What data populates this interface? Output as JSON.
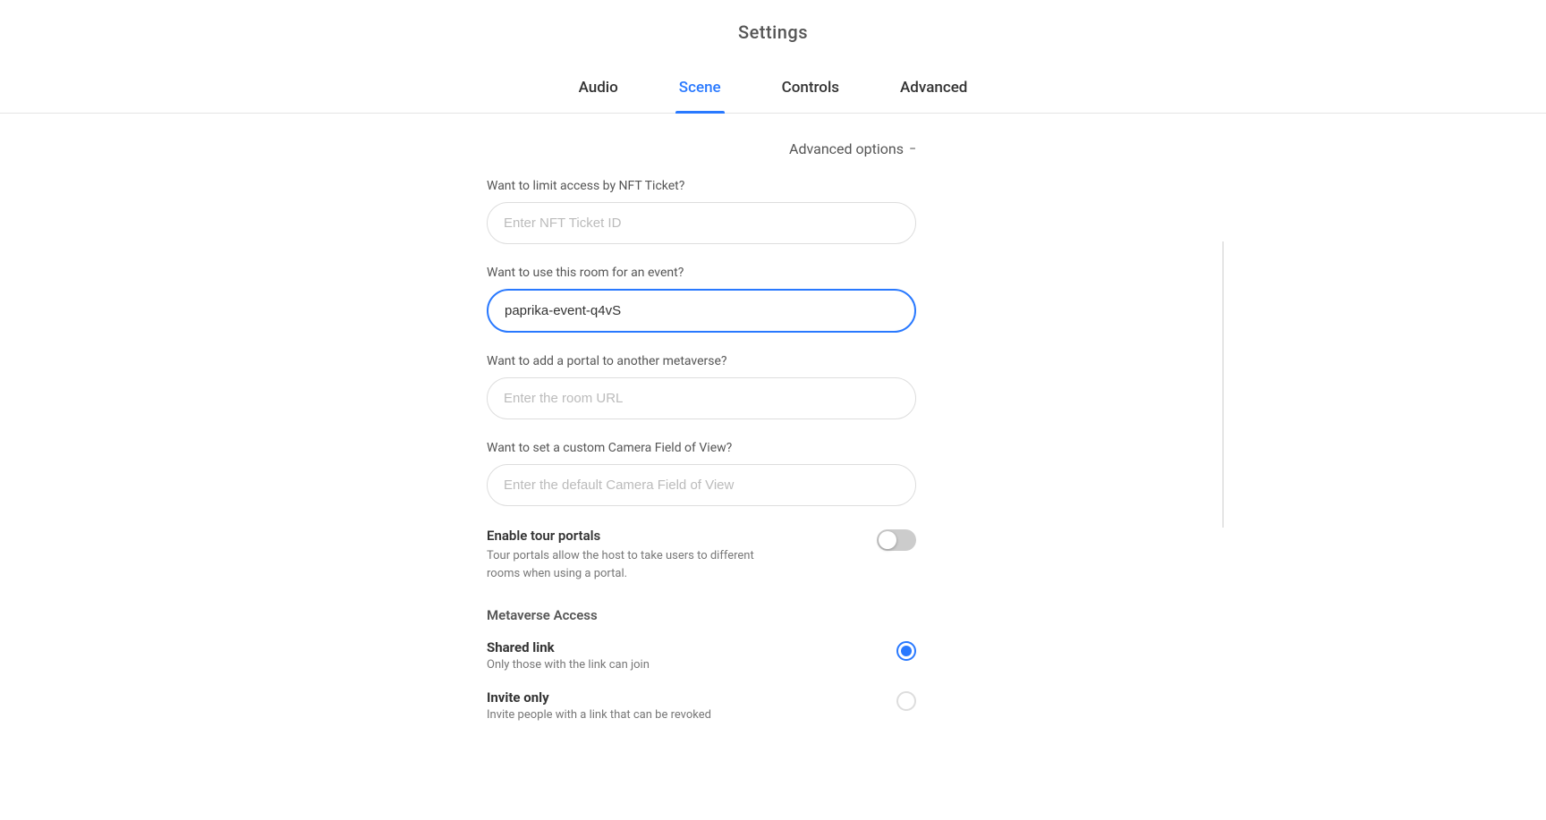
{
  "page": {
    "title": "Settings"
  },
  "tabs": [
    {
      "id": "audio",
      "label": "Audio",
      "active": false
    },
    {
      "id": "scene",
      "label": "Scene",
      "active": true
    },
    {
      "id": "controls",
      "label": "Controls",
      "active": false
    },
    {
      "id": "advanced",
      "label": "Advanced",
      "active": false
    }
  ],
  "advanced_options": {
    "header_label": "Advanced options",
    "chevron": "−"
  },
  "form": {
    "nft_ticket": {
      "label": "Want to limit access by NFT Ticket?",
      "placeholder": "Enter NFT Ticket ID",
      "value": ""
    },
    "event_room": {
      "label": "Want to use this room for an event?",
      "placeholder": "",
      "value": "paprika-event-q4vS"
    },
    "portal_url": {
      "label": "Want to add a portal to another metaverse?",
      "placeholder": "Enter the room URL",
      "value": ""
    },
    "camera_fov": {
      "label": "Want to set a custom Camera Field of View?",
      "placeholder": "Enter the default Camera Field of View",
      "value": ""
    }
  },
  "toggle": {
    "label": "Enable tour portals",
    "description": "Tour portals allow the host to take users to different rooms when using a portal.",
    "enabled": false
  },
  "metaverse_access": {
    "section_label": "Metaverse Access",
    "options": [
      {
        "id": "shared_link",
        "label": "Shared link",
        "description": "Only those with the link can join",
        "selected": true
      },
      {
        "id": "invite_only",
        "label": "Invite only",
        "description": "Invite people with a link that can be revoked",
        "selected": false
      }
    ]
  }
}
